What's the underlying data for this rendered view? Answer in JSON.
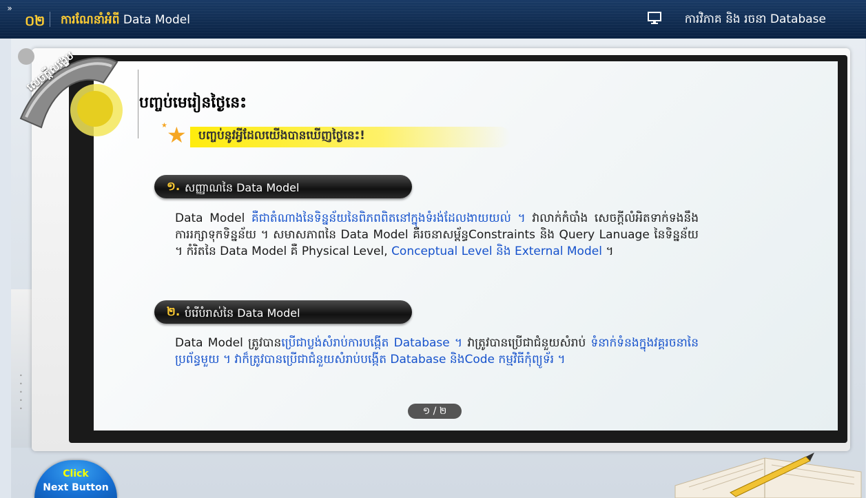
{
  "header": {
    "lesson_number": "០២",
    "lesson_title_kh": "ការណែនាំអំពី",
    "lesson_title_en": "Data Model",
    "course_title": "ការវិភាគ និង រចនា Database",
    "expand_icon": "»"
  },
  "badge": {
    "label": "សេចក្តីសង្ខេប"
  },
  "slide": {
    "title": "បញ្ចប់មេរៀនថ្ងៃនេះ",
    "subtitle": "បញ្ចប់នូវអ្វីដែលយើងបានឃើញថ្ងៃនេះ!",
    "section1": {
      "number": "១.",
      "label_kh": "សញ្ញាណនៃ",
      "label_en": "Data Model",
      "para_line1_a": "Data Model ",
      "para_line1_b": "គឺជាតំណាងនៃទិន្នន័យនៃពិភពពិតនៅក្នុងទំរង់ដែលងាយយល់ ។",
      "para_line2": "វាលាក់កំបាំង សេចក្តីលំអិតទាក់ទងនឹងការរក្សាទុកទិន្នន័យ ។ សមាសភាពនៃ Data Model គឺរចនាសម្ព័ន្ធConstraints និង Query Lanuage នៃទិន្នន័យ ។ កំរិតនៃ Data Model គឺ Physical Level, ",
      "para_line2_blue": "Conceptual Level និង External Model",
      "para_end": " ។"
    },
    "section2": {
      "number": "២.",
      "label_kh": "បំរើបំរាស់នៃ",
      "label_en": "Data Model",
      "para_a": "Data Model ត្រូវបាន",
      "para_b": "ប្រើជាប្លង់សំរាប់ការបង្កើត Database ។",
      "para_c": " វាត្រូវបានប្រើជាជំនួយសំរាប់ ",
      "para_d": "ទំនាក់ទំនងក្នុងវគ្គរចនានៃប្រព័ន្ធមួយ ។ វាក៏ត្រូវបានប្រើជាជំនួយសំរាប់បង្កើត Database និងCode កម្មវិធីកុំព្យូទ័រ ។"
    },
    "page_indicator": "១ / ២"
  },
  "next_button": {
    "line1": "Click",
    "line2": "Next Button"
  },
  "colors": {
    "accent_yellow": "#ffcc33",
    "link_blue": "#1652cc",
    "header_bg": "#0d2a4f"
  }
}
